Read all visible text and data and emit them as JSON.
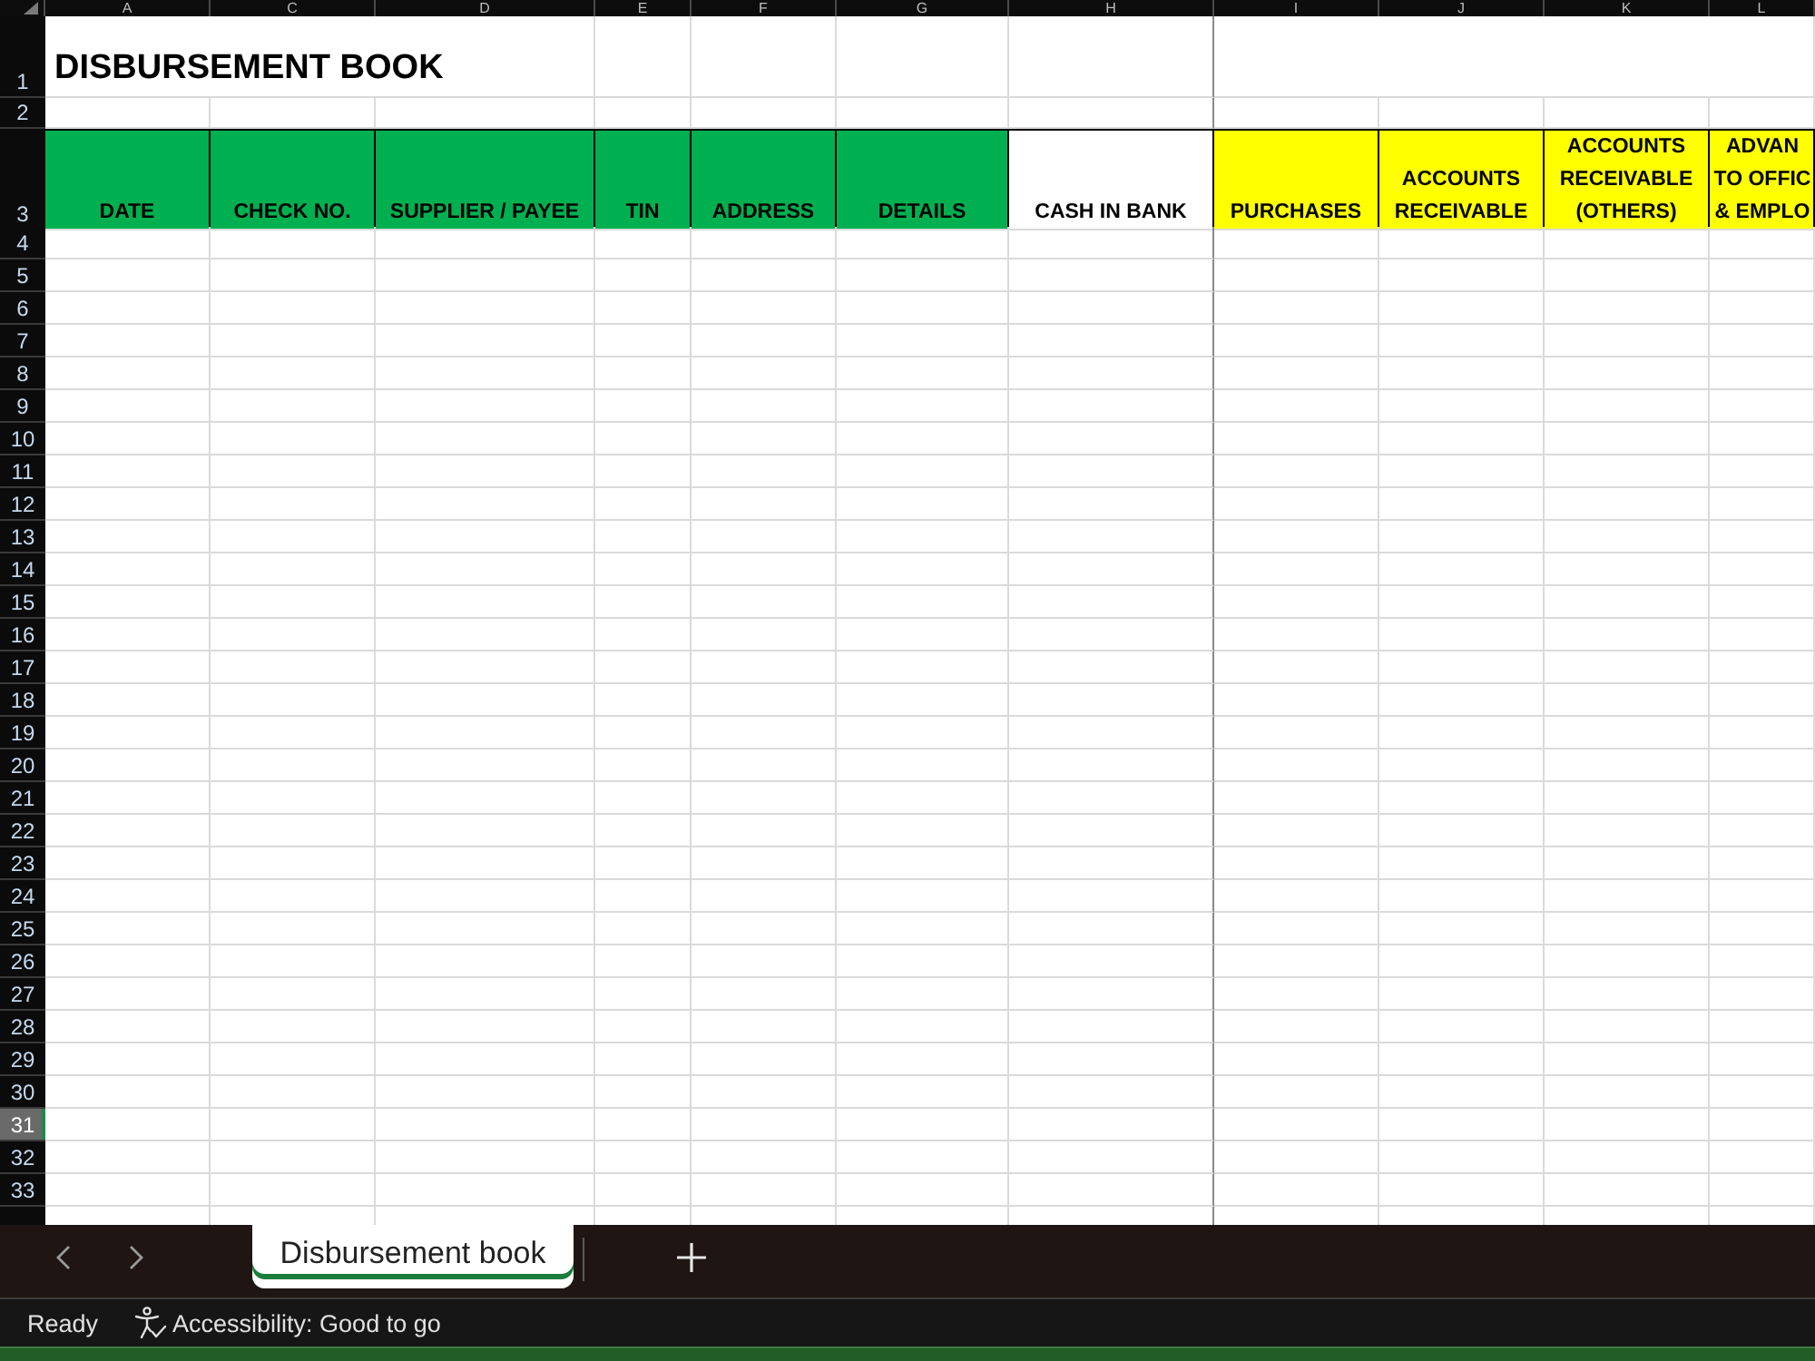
{
  "column_letters": [
    "A",
    "C",
    "D",
    "E",
    "F",
    "G",
    "H",
    "I",
    "J",
    "K",
    "L"
  ],
  "title": "DISBURSEMENT BOOK",
  "header_row": [
    {
      "label": "DATE",
      "color": "#00b050"
    },
    {
      "label": "CHECK NO.",
      "color": "#00b050"
    },
    {
      "label": "SUPPLIER / PAYEE",
      "color": "#00b050"
    },
    {
      "label": "TIN",
      "color": "#00b050"
    },
    {
      "label": "ADDRESS",
      "color": "#00b050"
    },
    {
      "label": "DETAILS",
      "color": "#00b050"
    },
    {
      "label": "CASH IN BANK",
      "color": "#ffffff"
    },
    {
      "label": "PURCHASES",
      "color": "#ffff00"
    },
    {
      "label": "ACCOUNTS RECEIVABLE",
      "color": "#ffff00"
    },
    {
      "label": "ACCOUNTS RECEIVABLE (OTHERS)",
      "color": "#ffff00"
    },
    {
      "label": "ADVAN TO OFFIC & EMPLO",
      "color": "#ffff00"
    }
  ],
  "rows": [
    {
      "number": "1",
      "selected": false
    },
    {
      "number": "2",
      "selected": false
    },
    {
      "number": "3",
      "selected": false
    },
    {
      "number": "4",
      "selected": false
    },
    {
      "number": "5",
      "selected": false
    },
    {
      "number": "6",
      "selected": false
    },
    {
      "number": "7",
      "selected": false
    },
    {
      "number": "8",
      "selected": false
    },
    {
      "number": "9",
      "selected": false
    },
    {
      "number": "10",
      "selected": false
    },
    {
      "number": "11",
      "selected": false
    },
    {
      "number": "12",
      "selected": false
    },
    {
      "number": "13",
      "selected": false
    },
    {
      "number": "14",
      "selected": false
    },
    {
      "number": "15",
      "selected": false
    },
    {
      "number": "16",
      "selected": false
    },
    {
      "number": "17",
      "selected": false
    },
    {
      "number": "18",
      "selected": false
    },
    {
      "number": "19",
      "selected": false
    },
    {
      "number": "20",
      "selected": false
    },
    {
      "number": "21",
      "selected": false
    },
    {
      "number": "22",
      "selected": false
    },
    {
      "number": "23",
      "selected": false
    },
    {
      "number": "24",
      "selected": false
    },
    {
      "number": "25",
      "selected": false
    },
    {
      "number": "26",
      "selected": false
    },
    {
      "number": "27",
      "selected": false
    },
    {
      "number": "28",
      "selected": false
    },
    {
      "number": "29",
      "selected": false
    },
    {
      "number": "30",
      "selected": false
    },
    {
      "number": "31",
      "selected": true
    },
    {
      "number": "32",
      "selected": false
    },
    {
      "number": "33",
      "selected": false
    }
  ],
  "sheet_tabs": [
    {
      "label": "Disbursement book",
      "selected": true
    }
  ],
  "status_bar": {
    "mode": "Ready",
    "accessibility": "Accessibility: Good to go"
  }
}
